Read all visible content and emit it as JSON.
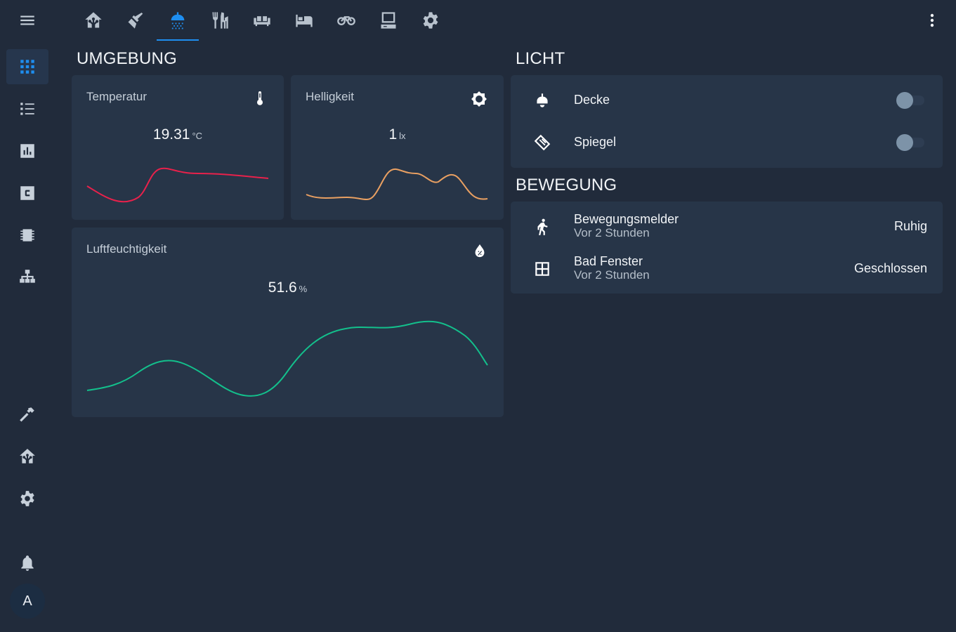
{
  "sidebar": {
    "items": [
      {
        "icon": "grid-icon",
        "active": true
      },
      {
        "icon": "list-icon"
      },
      {
        "icon": "chart-icon"
      },
      {
        "icon": "code-c-icon"
      },
      {
        "icon": "chip-icon"
      },
      {
        "icon": "sitemap-icon"
      },
      {
        "icon": "hammer-icon"
      },
      {
        "icon": "home-assistant-icon"
      },
      {
        "icon": "gear-icon"
      },
      {
        "icon": "bell-icon"
      }
    ],
    "avatar_initial": "A"
  },
  "tabs": [
    {
      "icon": "home-assistant-icon"
    },
    {
      "icon": "broom-icon"
    },
    {
      "icon": "shower-icon",
      "active": true
    },
    {
      "icon": "silverware-icon"
    },
    {
      "icon": "sofa-icon"
    },
    {
      "icon": "bed-icon"
    },
    {
      "icon": "bike-icon"
    },
    {
      "icon": "desktop-icon"
    },
    {
      "icon": "gear-icon"
    }
  ],
  "accent_color": "#1e8ef0",
  "sections": {
    "umgebung": "UMGEBUNG",
    "licht": "LICHT",
    "bewegung": "BEWEGUNG"
  },
  "sensors": {
    "temperature": {
      "title": "Temperatur",
      "value": "19.31",
      "unit": "°C",
      "icon": "thermometer-icon",
      "color": "#e8214b"
    },
    "brightness": {
      "title": "Helligkeit",
      "value": "1",
      "unit": "lx",
      "icon": "brightness-icon",
      "color": "#e9a062"
    },
    "humidity": {
      "title": "Luftfeuchtigkeit",
      "value": "51.6",
      "unit": "%",
      "icon": "water-percent-icon",
      "color": "#13c08c"
    }
  },
  "lights": [
    {
      "name": "Decke",
      "icon": "ceiling-light-icon",
      "on": false
    },
    {
      "name": "Spiegel",
      "icon": "mirror-icon",
      "on": false
    }
  ],
  "motion": [
    {
      "name": "Bewegungsmelder",
      "sub": "Vor 2 Stunden",
      "state": "Ruhig",
      "icon": "walk-icon"
    },
    {
      "name": "Bad Fenster",
      "sub": "Vor 2 Stunden",
      "state": "Geschlossen",
      "icon": "window-icon"
    }
  ]
}
